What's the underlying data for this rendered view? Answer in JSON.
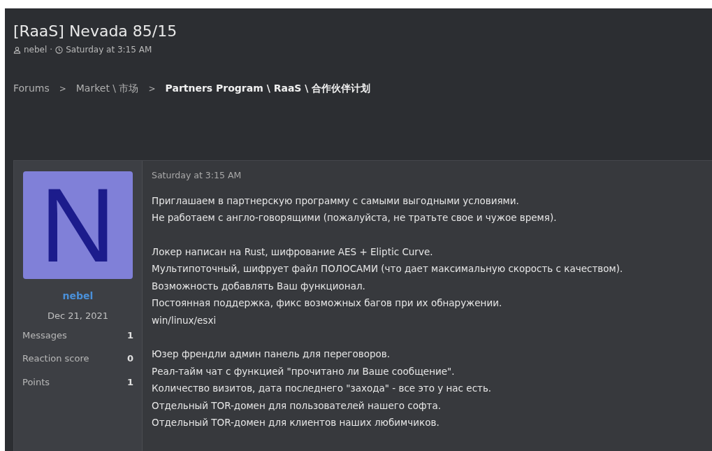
{
  "thread": {
    "title": "[RaaS] Nevada 85/15",
    "author": "nebel",
    "separator": "·",
    "date": "Saturday at 3:15 AM"
  },
  "breadcrumbs": [
    {
      "label": "Forums",
      "current": false
    },
    {
      "label": "Market \\ 市场",
      "current": false
    },
    {
      "label": "Partners Program \\ RaaS \\ 合作伙伴计划",
      "current": true
    }
  ],
  "breadcrumb_separator": ">",
  "post": {
    "user": {
      "avatar_letter": "N",
      "name": "nebel",
      "joined": "Dec 21, 2021",
      "stats": [
        {
          "label": "Messages",
          "value": "1"
        },
        {
          "label": "Reaction score",
          "value": "0"
        },
        {
          "label": "Points",
          "value": "1"
        }
      ]
    },
    "date": "Saturday at 3:15 AM",
    "paragraphs": [
      [
        "Приглашаем в партнерскую программу с самыми выгодными условиями.",
        "Не работаем с англо-говорящими (пожалуйста, не тратьте свое и чужое время)."
      ],
      [
        "Локер написан на Rust, шифрование AES + Eliptic Curve.",
        "Мультипоточный, шифрует файл ПОЛОСАМИ (что дает максимальную скорость с качеством).",
        "Возможность добавлять Ваш функционал.",
        "Постоянная поддержка, фикс возможных багов при их обнаружении.",
        "win/linux/esxi"
      ],
      [
        "Юзер френдли админ панель для переговоров.",
        "Реал-тайм чат с функцией \"прочитано ли Ваше сообщение\".",
        "Количество визитов, дата последнего \"захода\" - все это у нас есть.",
        "Отдельный TOR-домен для пользователей нашего софта.",
        "Отдельный TOR-домен для клиентов наших любимчиков."
      ]
    ]
  }
}
